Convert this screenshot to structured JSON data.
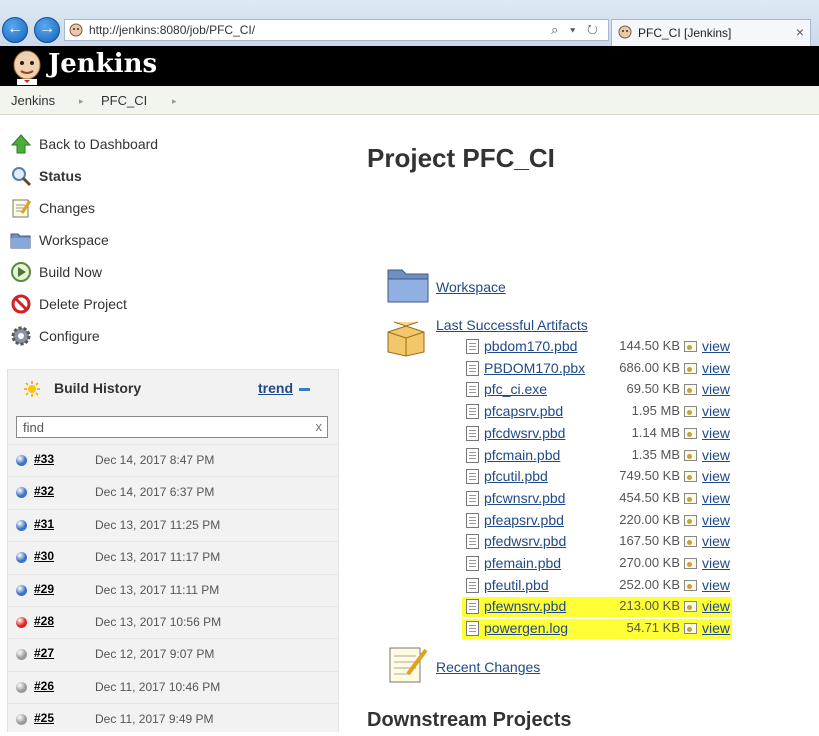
{
  "browser": {
    "url": "http://jenkins:8080/job/PFC_CI/",
    "tab_title": "PFC_CI [Jenkins]",
    "back_glyph": "←",
    "forward_glyph": "→",
    "address_icons": "⌕ ▾ ↻",
    "tab_close": "×"
  },
  "header": {
    "brand": "Jenkins"
  },
  "breadcrumbs": {
    "root": "Jenkins",
    "job": "PFC_CI",
    "separator": "▸"
  },
  "sidebar": {
    "tasks": [
      {
        "label": "Back to Dashboard",
        "icon": "up-arrow-icon"
      },
      {
        "label": "Status",
        "icon": "magnifier-icon"
      },
      {
        "label": "Changes",
        "icon": "notepad-icon"
      },
      {
        "label": "Workspace",
        "icon": "folder-icon"
      },
      {
        "label": "Build Now",
        "icon": "clock-play-icon"
      },
      {
        "label": "Delete Project",
        "icon": "no-entry-icon"
      },
      {
        "label": "Configure",
        "icon": "gear-icon"
      }
    ]
  },
  "build_history": {
    "title": "Build History",
    "trend_label": "trend",
    "find_placeholder": "find",
    "clear_glyph": "x",
    "builds": [
      {
        "number": "#33",
        "date": "Dec 14, 2017 8:47 PM",
        "status": "success"
      },
      {
        "number": "#32",
        "date": "Dec 14, 2017 6:37 PM",
        "status": "success"
      },
      {
        "number": "#31",
        "date": "Dec 13, 2017 11:25 PM",
        "status": "success"
      },
      {
        "number": "#30",
        "date": "Dec 13, 2017 11:17 PM",
        "status": "success"
      },
      {
        "number": "#29",
        "date": "Dec 13, 2017 11:11 PM",
        "status": "success"
      },
      {
        "number": "#28",
        "date": "Dec 13, 2017 10:56 PM",
        "status": "failed"
      },
      {
        "number": "#27",
        "date": "Dec 12, 2017 9:07 PM",
        "status": "aborted"
      },
      {
        "number": "#26",
        "date": "Dec 11, 2017 10:46 PM",
        "status": "aborted"
      },
      {
        "number": "#25",
        "date": "Dec 11, 2017 9:49 PM",
        "status": "aborted"
      }
    ]
  },
  "status_colors": {
    "success": "#3e6fc9",
    "failed": "#d92424",
    "aborted": "#9a9a9a"
  },
  "main": {
    "title": "Project PFC_CI",
    "workspace_label": "Workspace",
    "artifacts_label": "Last Successful Artifacts",
    "recent_changes_label": "Recent Changes",
    "downstream_title": "Downstream Projects",
    "artifacts": [
      {
        "name": "pbdom170.pbd",
        "size": "144.50 KB",
        "view": "view",
        "highlighted": false
      },
      {
        "name": "PBDOM170.pbx",
        "size": "686.00 KB",
        "view": "view",
        "highlighted": false
      },
      {
        "name": "pfc_ci.exe",
        "size": "69.50 KB",
        "view": "view",
        "highlighted": false
      },
      {
        "name": "pfcapsrv.pbd",
        "size": "1.95 MB",
        "view": "view",
        "highlighted": false
      },
      {
        "name": "pfcdwsrv.pbd",
        "size": "1.14 MB",
        "view": "view",
        "highlighted": false
      },
      {
        "name": "pfcmain.pbd",
        "size": "1.35 MB",
        "view": "view",
        "highlighted": false
      },
      {
        "name": "pfcutil.pbd",
        "size": "749.50 KB",
        "view": "view",
        "highlighted": false
      },
      {
        "name": "pfcwnsrv.pbd",
        "size": "454.50 KB",
        "view": "view",
        "highlighted": false
      },
      {
        "name": "pfeapsrv.pbd",
        "size": "220.00 KB",
        "view": "view",
        "highlighted": false
      },
      {
        "name": "pfedwsrv.pbd",
        "size": "167.50 KB",
        "view": "view",
        "highlighted": false
      },
      {
        "name": "pfemain.pbd",
        "size": "270.00 KB",
        "view": "view",
        "highlighted": false
      },
      {
        "name": "pfeutil.pbd",
        "size": "252.00 KB",
        "view": "view",
        "highlighted": false
      },
      {
        "name": "pfewnsrv.pbd",
        "size": "213.00 KB",
        "view": "view",
        "highlighted": true
      },
      {
        "name": "powergen.log",
        "size": "54.71 KB",
        "view": "view",
        "highlighted": true
      }
    ]
  },
  "highlight_color": "#ffff36"
}
